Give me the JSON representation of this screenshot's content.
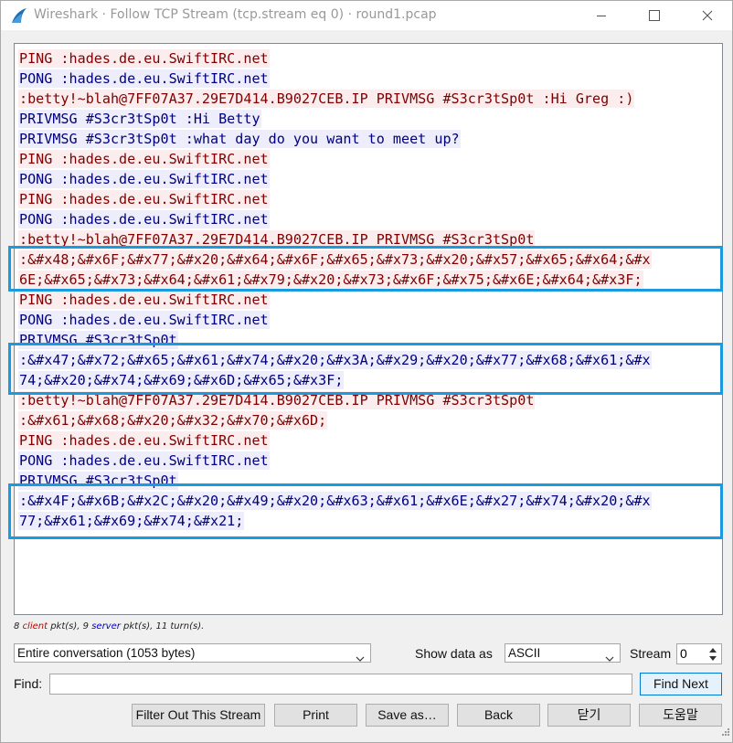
{
  "window": {
    "title": "Wireshark · Follow TCP Stream (tcp.stream eq 0) · round1.pcap"
  },
  "stream_lines": [
    {
      "dir": "client",
      "text": "PING :hades.de.eu.SwiftIRC.net"
    },
    {
      "dir": "server",
      "text": "PONG :hades.de.eu.SwiftIRC.net"
    },
    {
      "dir": "client",
      "text": ":betty!~blah@7FF07A37.29E7D414.B9027CEB.IP PRIVMSG #S3cr3tSp0t :Hi Greg :)"
    },
    {
      "dir": "server",
      "text": "PRIVMSG #S3cr3tSp0t :Hi Betty"
    },
    {
      "dir": "server",
      "text": "PRIVMSG #S3cr3tSp0t :what day do you want to meet up?"
    },
    {
      "dir": "client",
      "text": "PING :hades.de.eu.SwiftIRC.net"
    },
    {
      "dir": "server",
      "text": "PONG :hades.de.eu.SwiftIRC.net"
    },
    {
      "dir": "client",
      "text": "PING :hades.de.eu.SwiftIRC.net"
    },
    {
      "dir": "server",
      "text": "PONG :hades.de.eu.SwiftIRC.net"
    },
    {
      "dir": "client",
      "text": ":betty!~blah@7FF07A37.29E7D414.B9027CEB.IP PRIVMSG #S3cr3tSp0t"
    },
    {
      "dir": "client",
      "text": ":&#x48;&#x6F;&#x77;&#x20;&#x64;&#x6F;&#x65;&#x73;&#x20;&#x57;&#x65;&#x64;&#x"
    },
    {
      "dir": "client",
      "text": "6E;&#x65;&#x73;&#x64;&#x61;&#x79;&#x20;&#x73;&#x6F;&#x75;&#x6E;&#x64;&#x3F;"
    },
    {
      "dir": "client",
      "text": "PING :hades.de.eu.SwiftIRC.net"
    },
    {
      "dir": "server",
      "text": "PONG :hades.de.eu.SwiftIRC.net"
    },
    {
      "dir": "server",
      "text": "PRIVMSG #S3cr3tSp0t"
    },
    {
      "dir": "server",
      "text": ":&#x47;&#x72;&#x65;&#x61;&#x74;&#x20;&#x3A;&#x29;&#x20;&#x77;&#x68;&#x61;&#x"
    },
    {
      "dir": "server",
      "text": "74;&#x20;&#x74;&#x69;&#x6D;&#x65;&#x3F;"
    },
    {
      "dir": "client",
      "text": ":betty!~blah@7FF07A37.29E7D414.B9027CEB.IP PRIVMSG #S3cr3tSp0t"
    },
    {
      "dir": "client",
      "text": ":&#x61;&#x68;&#x20;&#x32;&#x70;&#x6D;"
    },
    {
      "dir": "client",
      "text": "PING :hades.de.eu.SwiftIRC.net"
    },
    {
      "dir": "server",
      "text": "PONG :hades.de.eu.SwiftIRC.net"
    },
    {
      "dir": "server",
      "text": "PRIVMSG #S3cr3tSp0t"
    },
    {
      "dir": "server",
      "text": ":&#x4F;&#x6B;&#x2C;&#x20;&#x49;&#x20;&#x63;&#x61;&#x6E;&#x27;&#x74;&#x20;&#x"
    },
    {
      "dir": "server",
      "text": "77;&#x61;&#x69;&#x74;&#x21;"
    }
  ],
  "status": {
    "client_count": "8",
    "client_word": "client",
    "client_suffix": " pkt(s), ",
    "server_count": "9",
    "server_word": "server",
    "server_suffix": " pkt(s), ",
    "turns": "11 turn(s)."
  },
  "controls": {
    "conversation_select": "Entire conversation (1053 bytes)",
    "show_data_label": "Show data as",
    "show_data_select": "ASCII",
    "stream_label": "Stream",
    "stream_value": "0",
    "find_label": "Find:",
    "find_value": "",
    "find_next": "Find Next"
  },
  "buttons": {
    "filter_out": "Filter Out This Stream",
    "print": "Print",
    "save_as": "Save as…",
    "back": "Back",
    "close": "닫기",
    "help": "도움말"
  },
  "colors": {
    "client_bg": "#fbeded",
    "client_fg": "#7f0000",
    "server_bg": "#ededfb",
    "server_fg": "#00007f",
    "highlight": "#1a9be0"
  }
}
